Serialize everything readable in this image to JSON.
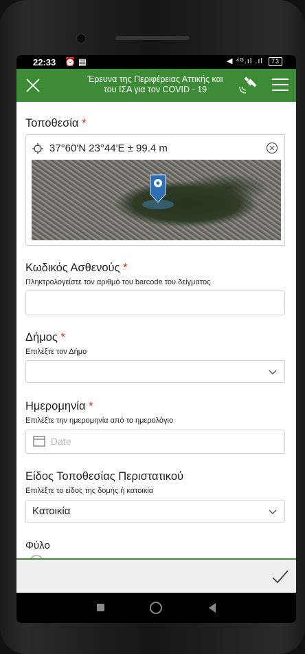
{
  "status_bar": {
    "time": "22:33",
    "left_icons": "⏰ ▦",
    "right_icons": "◀ ⁴ᴳ.ıl .ıl",
    "battery": "73"
  },
  "app_bar": {
    "title_line1": "Έρευνα της Περιφέρειας Αττικής και",
    "title_line2": "του ΙΣΑ για τον COVID - 19",
    "accent_color": "#3d8b36"
  },
  "location": {
    "label": "Τοποθεσία",
    "required_mark": "*",
    "coordinates": "37°60'N 23°44'E ± 99.4 m",
    "map_icon": "map-pin-icon"
  },
  "patient_code": {
    "label": "Κωδικός Ασθενούς",
    "required_mark": "*",
    "helper": "Πληκτρολογείστε τον αριθμό του barcode του δείγματος",
    "value": ""
  },
  "municipality": {
    "label": "Δήμος",
    "required_mark": "*",
    "helper": "Επιλέξτε τον Δήμο",
    "value": ""
  },
  "date": {
    "label": "Ημερομηνία",
    "required_mark": "*",
    "helper": "Επιλέξτε την ημερομηνία από το ημερολόγιο",
    "placeholder": "Date"
  },
  "site_type": {
    "label": "Είδος Τοποθεσίας Περιστατικού",
    "helper": "Επιλέξτε το είδος της δομής ή κατοικία",
    "value": "Κατοικία"
  },
  "sex": {
    "label": "Φύλο"
  },
  "required_color": "#d0301f"
}
